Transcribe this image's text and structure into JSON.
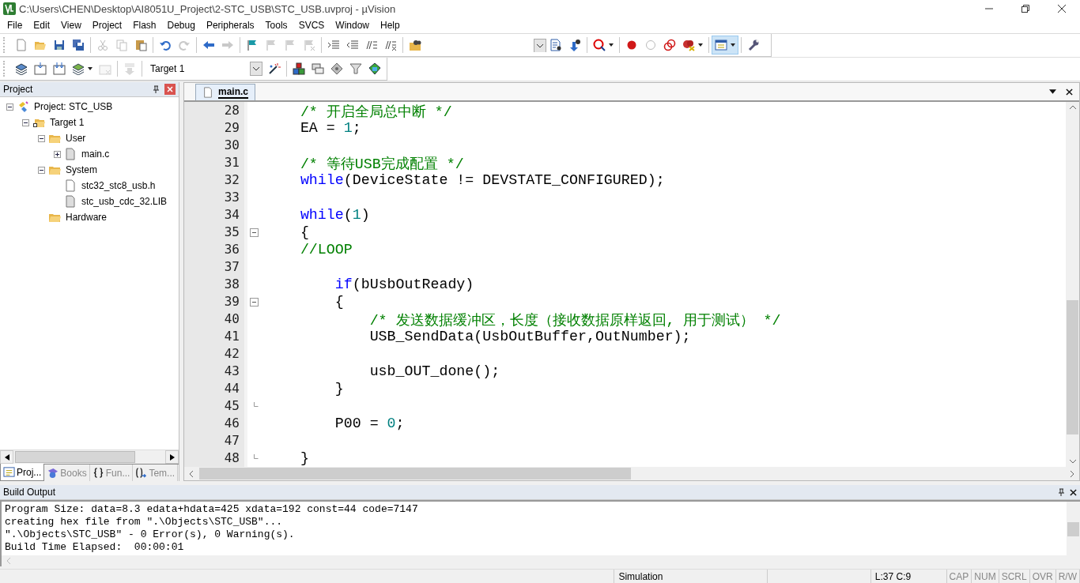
{
  "window": {
    "title": "C:\\Users\\CHEN\\Desktop\\AI8051U_Project\\2-STC_USB\\STC_USB.uvproj - µVision"
  },
  "menu": [
    "File",
    "Edit",
    "View",
    "Project",
    "Flash",
    "Debug",
    "Peripherals",
    "Tools",
    "SVCS",
    "Window",
    "Help"
  ],
  "toolbar_1": [
    {
      "kind": "new",
      "disabled": false,
      "pressed": false
    },
    {
      "kind": "open",
      "disabled": false,
      "pressed": false
    },
    {
      "kind": "save",
      "disabled": false,
      "pressed": false
    },
    {
      "kind": "save-all",
      "disabled": false,
      "pressed": false
    },
    {
      "kind": "separator"
    },
    {
      "kind": "cut",
      "disabled": true,
      "pressed": false
    },
    {
      "kind": "copy",
      "disabled": true,
      "pressed": false
    },
    {
      "kind": "paste",
      "disabled": false,
      "pressed": false
    },
    {
      "kind": "separator"
    },
    {
      "kind": "undo",
      "disabled": false,
      "pressed": false
    },
    {
      "kind": "redo",
      "disabled": true,
      "pressed": false
    },
    {
      "kind": "separator"
    },
    {
      "kind": "back",
      "disabled": false,
      "pressed": false
    },
    {
      "kind": "forward",
      "disabled": true,
      "pressed": false
    },
    {
      "kind": "separator"
    },
    {
      "kind": "bookmark",
      "disabled": false,
      "pressed": false
    },
    {
      "kind": "bookmark-prev",
      "disabled": true,
      "pressed": false
    },
    {
      "kind": "bookmark-next",
      "disabled": true,
      "pressed": false
    },
    {
      "kind": "bookmark-clear",
      "disabled": true,
      "pressed": false
    },
    {
      "kind": "separator"
    },
    {
      "kind": "indent",
      "disabled": false,
      "pressed": false
    },
    {
      "kind": "unindent",
      "disabled": false,
      "pressed": false
    },
    {
      "kind": "comment",
      "disabled": false,
      "pressed": false
    },
    {
      "kind": "uncomment",
      "disabled": false,
      "pressed": false
    },
    {
      "kind": "separator"
    },
    {
      "kind": "find-in-files",
      "disabled": false,
      "pressed": false
    },
    {
      "kind": "find-combo"
    },
    {
      "kind": "find",
      "disabled": false,
      "pressed": false
    },
    {
      "kind": "incremental-find",
      "disabled": false,
      "pressed": false
    },
    {
      "kind": "separator"
    },
    {
      "kind": "debug",
      "disabled": false,
      "pressed": false,
      "caret": true
    },
    {
      "kind": "separator"
    },
    {
      "kind": "breakpoint",
      "disabled": false,
      "pressed": false
    },
    {
      "kind": "breakpoint-off",
      "disabled": false,
      "pressed": false
    },
    {
      "kind": "breakpoints-toggle",
      "disabled": false,
      "pressed": false
    },
    {
      "kind": "breakpoints-kill",
      "disabled": false,
      "pressed": false,
      "caret": true
    },
    {
      "kind": "separator"
    },
    {
      "kind": "window-layout",
      "disabled": false,
      "pressed": true,
      "caret": true
    },
    {
      "kind": "separator"
    },
    {
      "kind": "wrench",
      "disabled": false,
      "pressed": false
    }
  ],
  "toolbar_2": [
    {
      "kind": "translate",
      "disabled": false,
      "pressed": false
    },
    {
      "kind": "build",
      "disabled": false,
      "pressed": false
    },
    {
      "kind": "rebuild",
      "disabled": false,
      "pressed": false
    },
    {
      "kind": "batch-build",
      "disabled": false,
      "pressed": false,
      "caret": true
    },
    {
      "kind": "stop-build",
      "disabled": true,
      "pressed": false
    },
    {
      "kind": "separator"
    },
    {
      "kind": "load",
      "disabled": true,
      "pressed": false
    },
    {
      "kind": "separator"
    },
    {
      "kind": "target-combo",
      "value": "Target 1"
    },
    {
      "kind": "wand",
      "disabled": false,
      "pressed": false
    },
    {
      "kind": "separator"
    },
    {
      "kind": "components",
      "disabled": false,
      "pressed": false
    },
    {
      "kind": "extensions",
      "disabled": false,
      "pressed": false
    },
    {
      "kind": "diamond",
      "disabled": false,
      "pressed": false
    },
    {
      "kind": "funnel",
      "disabled": false,
      "pressed": false
    },
    {
      "kind": "packs",
      "disabled": false,
      "pressed": false
    }
  ],
  "project_panel": {
    "title": "Project",
    "tree": [
      {
        "label": "Project: STC_USB",
        "kind": "project",
        "expanded": true,
        "children": [
          {
            "label": "Target 1",
            "kind": "target",
            "expanded": true,
            "children": [
              {
                "label": "User",
                "kind": "folder",
                "expanded": true,
                "children": [
                  {
                    "label": "main.c",
                    "kind": "source",
                    "expanded": false
                  }
                ]
              },
              {
                "label": "System",
                "kind": "folder",
                "expanded": true,
                "children": [
                  {
                    "label": "stc32_stc8_usb.h",
                    "kind": "header"
                  },
                  {
                    "label": "stc_usb_cdc_32.LIB",
                    "kind": "library"
                  }
                ]
              },
              {
                "label": "Hardware",
                "kind": "folder"
              }
            ]
          }
        ]
      }
    ],
    "tabs": [
      {
        "label": "Proj...",
        "kind": "project",
        "selected": true
      },
      {
        "label": "Books",
        "kind": "books",
        "selected": false
      },
      {
        "label": "Fun...",
        "kind": "functions",
        "selected": false
      },
      {
        "label": "Tem...",
        "kind": "templates",
        "selected": false
      }
    ]
  },
  "editor": {
    "tabs": [
      {
        "label": "main.c",
        "selected": true
      }
    ],
    "lines": [
      {
        "number": "28",
        "kind": "code",
        "segments": [
          {
            "kind": "comment",
            "text": "    /* 开启全局总中断 */"
          }
        ]
      },
      {
        "number": "29",
        "kind": "code",
        "segments": [
          {
            "kind": "plain",
            "text": "    EA = "
          },
          {
            "kind": "number",
            "text": "1"
          },
          {
            "kind": "plain",
            "text": ";"
          }
        ]
      },
      {
        "number": "30",
        "kind": "code"
      },
      {
        "number": "31",
        "kind": "code",
        "segments": [
          {
            "kind": "comment",
            "text": "    /* 等待USB完成配置 */"
          }
        ]
      },
      {
        "number": "32",
        "kind": "code",
        "segments": [
          {
            "kind": "keyword",
            "text": "    while"
          },
          {
            "kind": "plain",
            "text": "(DeviceState != DEVSTATE_CONFIGURED);"
          }
        ]
      },
      {
        "number": "33",
        "kind": "code"
      },
      {
        "number": "34",
        "kind": "code",
        "segments": [
          {
            "kind": "keyword",
            "text": "    while"
          },
          {
            "kind": "plain",
            "text": "("
          },
          {
            "kind": "number",
            "text": "1"
          },
          {
            "kind": "plain",
            "text": ")"
          }
        ]
      },
      {
        "number": "35",
        "kind": "fold-start",
        "segments": [
          {
            "kind": "plain",
            "text": "    {"
          }
        ]
      },
      {
        "number": "36",
        "kind": "code",
        "segments": [
          {
            "kind": "comment",
            "text": "    //LOOP"
          }
        ]
      },
      {
        "number": "37",
        "kind": "code"
      },
      {
        "number": "38",
        "kind": "code",
        "segments": [
          {
            "kind": "keyword",
            "text": "        if"
          },
          {
            "kind": "plain",
            "text": "(bUsbOutReady)"
          }
        ]
      },
      {
        "number": "39",
        "kind": "fold-start",
        "segments": [
          {
            "kind": "plain",
            "text": "        {"
          }
        ]
      },
      {
        "number": "40",
        "kind": "code",
        "segments": [
          {
            "kind": "comment",
            "text": "            /* 发送数据缓冲区，长度（接收数据原样返回, 用于测试） */"
          }
        ]
      },
      {
        "number": "41",
        "kind": "code",
        "segments": [
          {
            "kind": "plain",
            "text": "            USB_SendData(UsbOutBuffer,OutNumber);"
          }
        ]
      },
      {
        "number": "42",
        "kind": "code"
      },
      {
        "number": "43",
        "kind": "code",
        "segments": [
          {
            "kind": "plain",
            "text": "            usb_OUT_done();"
          }
        ]
      },
      {
        "number": "44",
        "kind": "code",
        "segments": [
          {
            "kind": "plain",
            "text": "        }"
          }
        ]
      },
      {
        "number": "45",
        "kind": "fold-end"
      },
      {
        "number": "46",
        "kind": "code",
        "segments": [
          {
            "kind": "plain",
            "text": "        P00 = "
          },
          {
            "kind": "number",
            "text": "0"
          },
          {
            "kind": "plain",
            "text": ";"
          }
        ]
      },
      {
        "number": "47",
        "kind": "code"
      },
      {
        "number": "48",
        "kind": "fold-end",
        "segments": [
          {
            "kind": "plain",
            "text": "    }"
          }
        ]
      }
    ]
  },
  "build_output": {
    "title": "Build Output",
    "lines": [
      "Program Size: data=8.3 edata+hdata=425 xdata=192 const=44 code=7147",
      "creating hex file from \".\\Objects\\STC_USB\"...",
      "\".\\Objects\\STC_USB\" - 0 Error(s), 0 Warning(s).",
      "Build Time Elapsed:  00:00:01"
    ]
  },
  "status_bar": {
    "mode": "Simulation",
    "position": "L:37 C:9",
    "indicators": [
      {
        "label": "CAP",
        "on": false
      },
      {
        "label": "NUM",
        "on": false
      },
      {
        "label": "SCRL",
        "on": false
      },
      {
        "label": "OVR",
        "on": false
      },
      {
        "label": "R/W",
        "on": false
      }
    ]
  }
}
